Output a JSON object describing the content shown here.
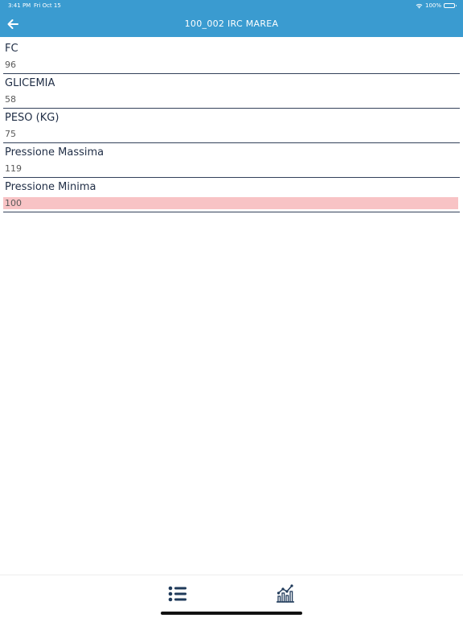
{
  "status_bar": {
    "time": "3:41 PM",
    "date": "Fri Oct 15",
    "battery": "100%"
  },
  "header": {
    "title": "100_002 IRC MAREA"
  },
  "items": [
    {
      "label": "FC",
      "value": "96",
      "alert": false
    },
    {
      "label": "GLICEMIA",
      "value": "58",
      "alert": false
    },
    {
      "label": "PESO (KG)",
      "value": "75",
      "alert": false
    },
    {
      "label": "Pressione Massima",
      "value": "119",
      "alert": false
    },
    {
      "label": "Pressione Minima",
      "value": "100",
      "alert": true
    }
  ],
  "tab_bar": {
    "tabs": [
      {
        "icon": "list-icon"
      },
      {
        "icon": "chart-icon"
      }
    ]
  },
  "colors": {
    "header_bg": "#3a9bd0",
    "alert_bg": "#f8c3c5",
    "tab_icon": "#1f3a5a"
  }
}
